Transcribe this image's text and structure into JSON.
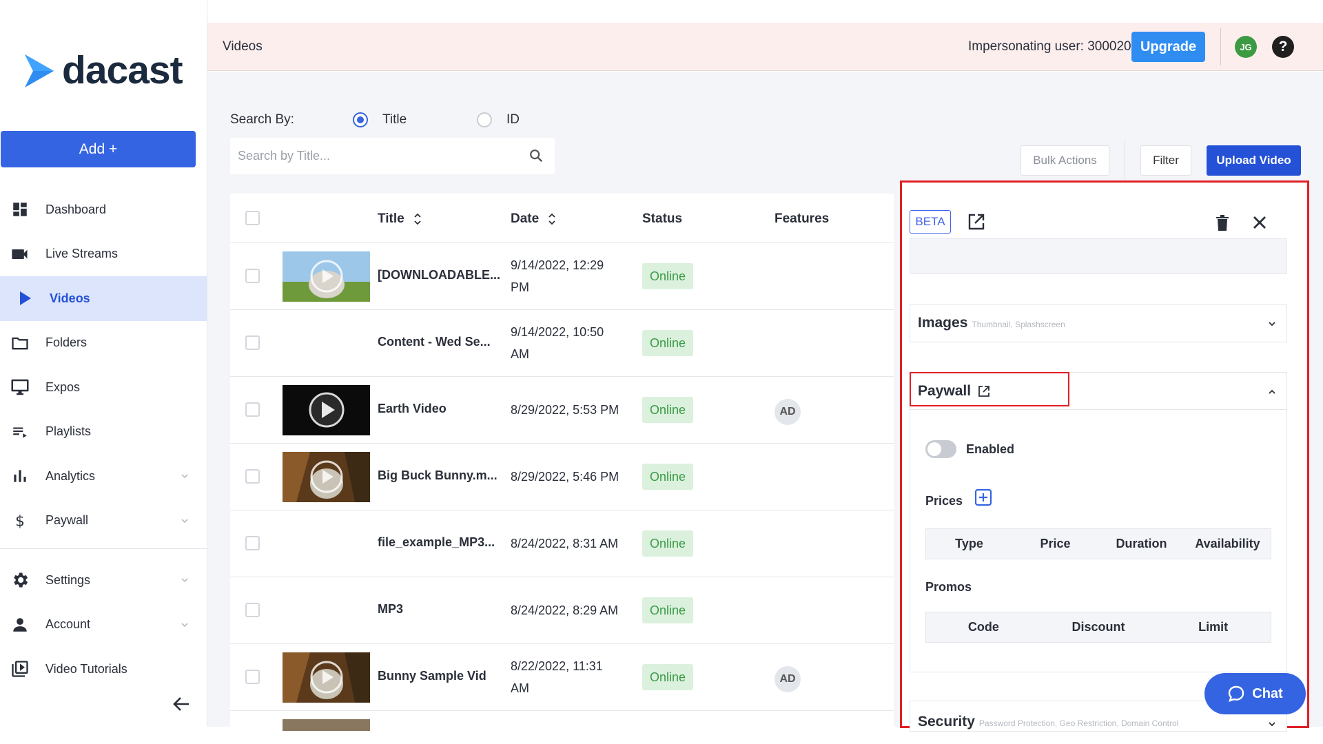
{
  "brand": {
    "name": "dacast"
  },
  "sidebar": {
    "add_label": "Add +",
    "items": [
      {
        "label": "Dashboard",
        "icon": "dashboard-icon",
        "active": false,
        "expandable": false
      },
      {
        "label": "Live Streams",
        "icon": "camera-icon",
        "active": false,
        "expandable": false
      },
      {
        "label": "Videos",
        "icon": "play-icon",
        "active": true,
        "expandable": false
      },
      {
        "label": "Folders",
        "icon": "folder-icon",
        "active": false,
        "expandable": false
      },
      {
        "label": "Expos",
        "icon": "monitor-icon",
        "active": false,
        "expandable": false
      },
      {
        "label": "Playlists",
        "icon": "playlist-icon",
        "active": false,
        "expandable": false
      },
      {
        "label": "Analytics",
        "icon": "bar-chart-icon",
        "active": false,
        "expandable": true
      },
      {
        "label": "Paywall",
        "icon": "dollar-icon",
        "active": false,
        "expandable": true
      },
      {
        "label": "Settings",
        "icon": "gear-icon",
        "active": false,
        "expandable": true
      },
      {
        "label": "Account",
        "icon": "person-icon",
        "active": false,
        "expandable": true
      },
      {
        "label": "Video Tutorials",
        "icon": "video-library-icon",
        "active": false,
        "expandable": false
      }
    ]
  },
  "header": {
    "page_name": "Videos",
    "impersonating": "Impersonating user: 300020",
    "upgrade_label": "Upgrade",
    "avatar_initials": "JG"
  },
  "search": {
    "label": "Search By:",
    "option_title": "Title",
    "option_id": "ID",
    "selected": "Title",
    "placeholder": "Search by Title...",
    "value": ""
  },
  "toolbar": {
    "bulk_label": "Bulk Actions",
    "filter_label": "Filter",
    "upload_label": "Upload Video"
  },
  "table": {
    "columns": {
      "title": "Title",
      "date": "Date",
      "status": "Status",
      "features": "Features"
    },
    "rows": [
      {
        "title": "[DOWNLOADABLE...",
        "date": "9/14/2022, 12:29 PM",
        "status": "Online",
        "feature": "",
        "thumb": "bunny"
      },
      {
        "title": "Content - Wed Se...",
        "date": "9/14/2022, 10:50 AM",
        "status": "Online",
        "feature": "",
        "thumb": ""
      },
      {
        "title": "Earth Video",
        "date": "8/29/2022, 5:53 PM",
        "status": "Online",
        "feature": "AD",
        "thumb": "dark"
      },
      {
        "title": "Big Buck Bunny.m...",
        "date": "8/29/2022, 5:46 PM",
        "status": "Online",
        "feature": "",
        "thumb": "forest"
      },
      {
        "title": "file_example_MP3...",
        "date": "8/24/2022, 8:31 AM",
        "status": "Online",
        "feature": "",
        "thumb": ""
      },
      {
        "title": "MP3",
        "date": "8/24/2022, 8:29 AM",
        "status": "Online",
        "feature": "",
        "thumb": ""
      },
      {
        "title": "Bunny Sample Vid",
        "date": "8/22/2022, 11:31 AM",
        "status": "Online",
        "feature": "AD",
        "thumb": "forest"
      }
    ]
  },
  "panel": {
    "beta_label": "BETA",
    "images": {
      "title": "Images",
      "subtitle": "Thumbnail, Splashscreen"
    },
    "paywall": {
      "title": "Paywall",
      "enabled_label": "Enabled",
      "enabled": false,
      "prices_label": "Prices",
      "price_columns": [
        "Type",
        "Price",
        "Duration",
        "Availability"
      ],
      "promos_label": "Promos",
      "promo_columns": [
        "Code",
        "Discount",
        "Limit"
      ]
    },
    "security": {
      "title": "Security",
      "subtitle": "Password Protection, Geo Restriction, Domain Control"
    }
  },
  "chat": {
    "label": "Chat"
  },
  "colors": {
    "primary": "#3564e3",
    "upgrade": "#2f8df2",
    "highlight": "#e01f26",
    "online_bg": "#dbf1de",
    "online_text": "#3a9a44",
    "topbar_bg": "#fdeeee"
  }
}
